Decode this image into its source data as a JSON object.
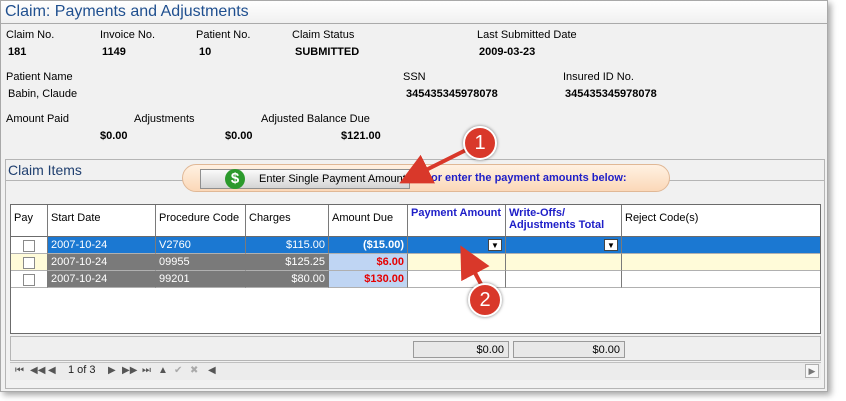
{
  "title": "Claim:  Payments and Adjustments",
  "claim": {
    "claim_no_label": "Claim No.",
    "claim_no": "181",
    "invoice_no_label": "Invoice No.",
    "invoice_no": "1149",
    "patient_no_label": "Patient No.",
    "patient_no": "10",
    "status_label": "Claim Status",
    "status": "SUBMITTED",
    "last_submitted_label": "Last Submitted Date",
    "last_submitted": "2009-03-23",
    "patient_name_label": "Patient Name",
    "patient_name": "Babin, Claude",
    "ssn_label": "SSN",
    "ssn": "345435345978078",
    "insured_id_label": "Insured ID No.",
    "insured_id": "345435345978078",
    "amount_paid_label": "Amount Paid",
    "amount_paid": "$0.00",
    "adjustments_label": "Adjustments",
    "adjustments": "$0.00",
    "adjusted_balance_label": "Adjusted Balance Due",
    "adjusted_balance": "$121.00"
  },
  "items": {
    "section_title": "Claim Items",
    "single_payment_button": "Enter Single Payment Amount",
    "or_text": "or enter the payment amounts below:",
    "columns": {
      "pay": "Pay",
      "start_date": "Start Date",
      "procedure_code": "Procedure Code",
      "charges": "Charges",
      "amount_due": "Amount Due",
      "payment_amount": "Payment Amount",
      "writeoffs": "Write-Offs/ Adjustments Total",
      "reject_codes": "Reject Code(s)"
    },
    "rows": [
      {
        "start_date": "2007-10-24",
        "procedure_code": "V2760",
        "charges": "$115.00",
        "amount_due": "($15.00)"
      },
      {
        "start_date": "2007-10-24",
        "procedure_code": "09955",
        "charges": "$125.25",
        "amount_due": "$6.00"
      },
      {
        "start_date": "2007-10-24",
        "procedure_code": "99201",
        "charges": "$80.00",
        "amount_due": "$130.00"
      }
    ],
    "total_payment": "$0.00",
    "total_writeoffs": "$0.00",
    "pager_text": "1 of 3"
  },
  "callouts": {
    "one": "1",
    "two": "2"
  },
  "colors": {
    "selected_row": "#1b78d2",
    "highlight_row": "#fffbd9",
    "dark_cell": "#7a7a7a",
    "amount_due_bg": "#bfd5f3",
    "negative_red": "#e60000",
    "title_blue": "#1f4f8f",
    "callout_red": "#d9382a"
  }
}
